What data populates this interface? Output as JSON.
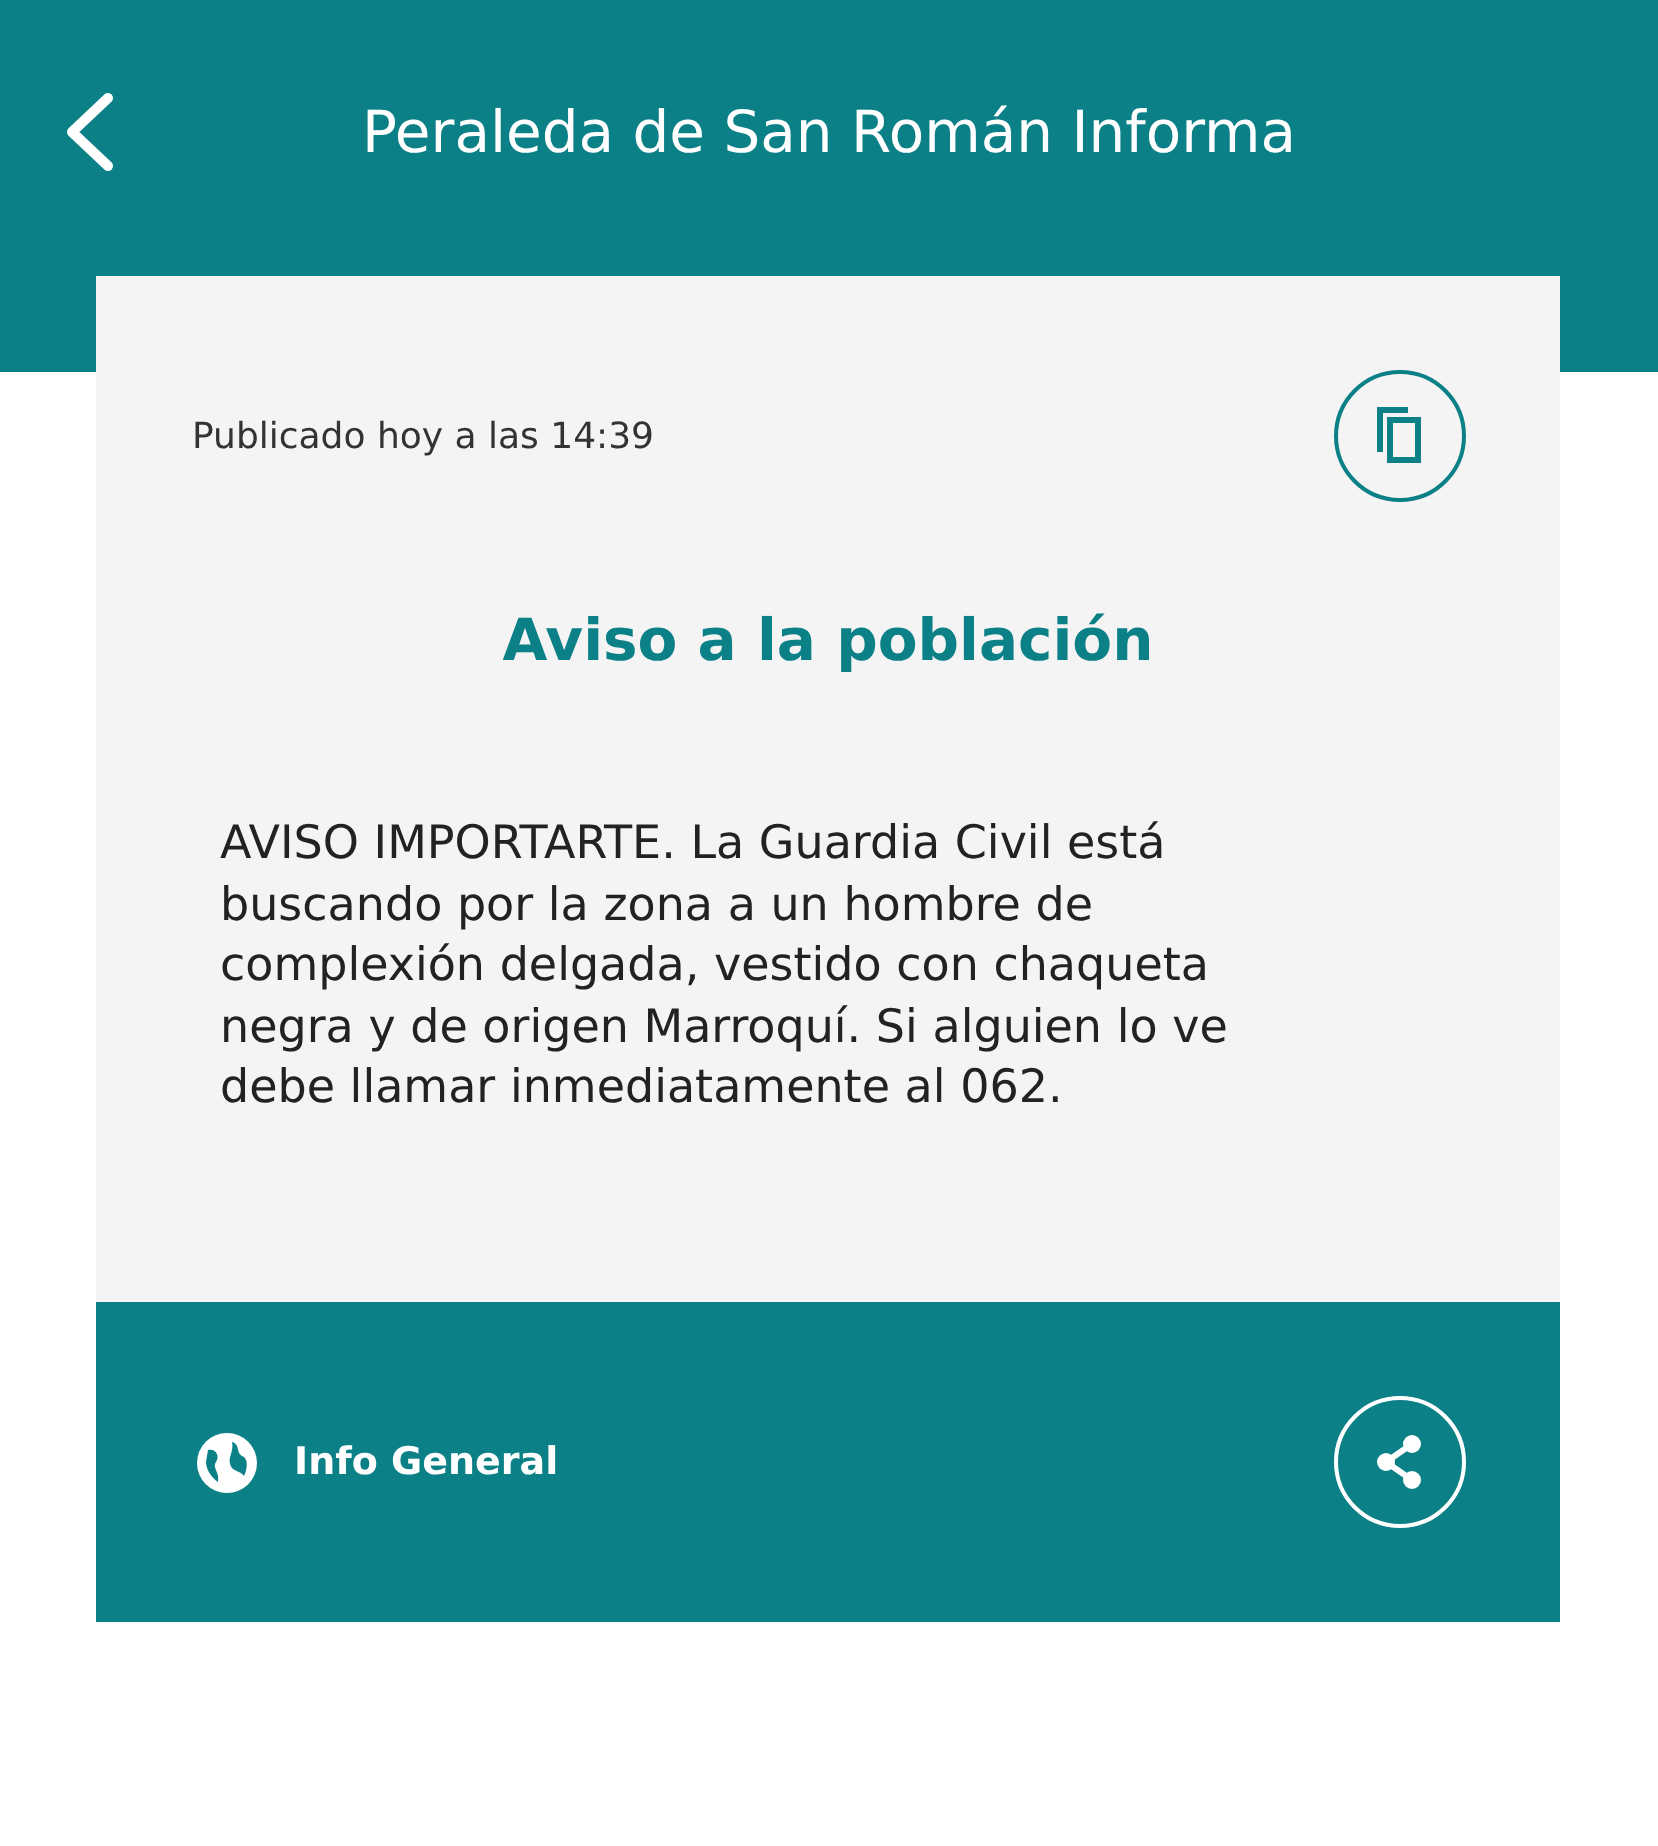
{
  "header": {
    "title": "Peraleda de San Román Informa"
  },
  "notice": {
    "published": "Publicado hoy a las 14:39",
    "title": "Aviso a la población",
    "body": "AVISO IMPORTARTE. La Guardia Civil está buscando por la zona a un hombre de complexión delgada, vestido con chaqueta negra y de origen Marroquí. Si alguien lo ve debe llamar inmediatamente al 062.",
    "category": "Info General"
  }
}
